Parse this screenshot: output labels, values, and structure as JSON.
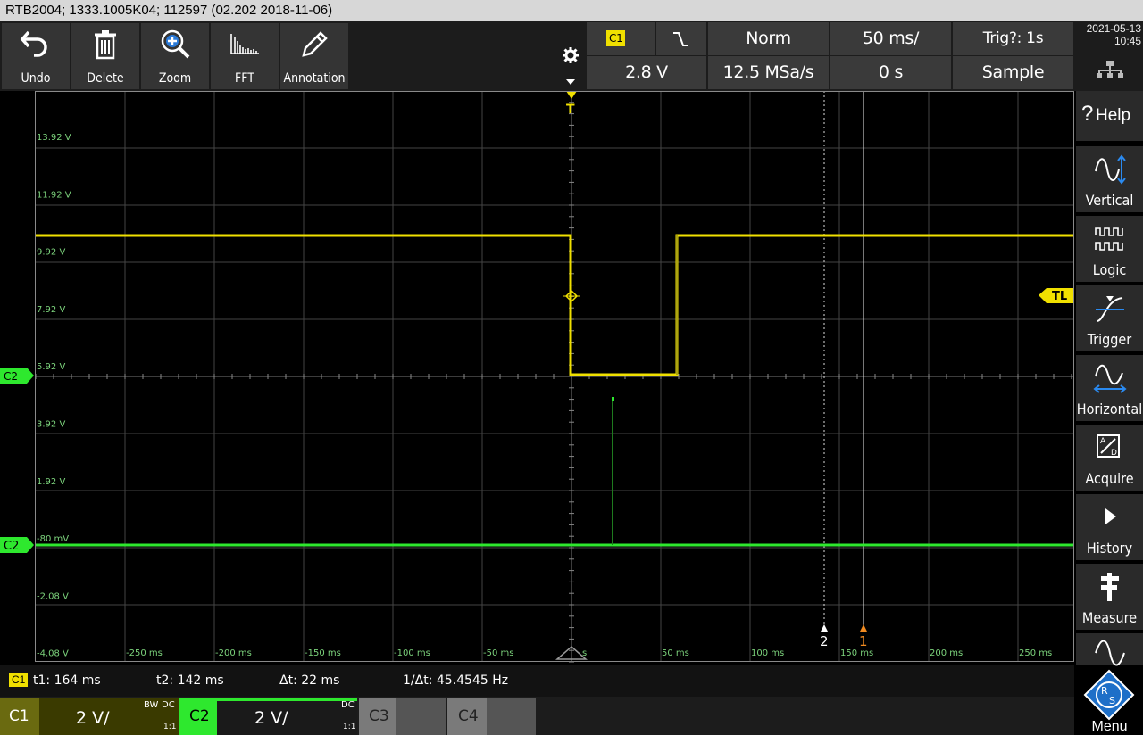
{
  "titlebar": {
    "text": "RTB2004; 1333.1005K04; 112597 (02.202 2018-11-06)"
  },
  "toolbar": {
    "tools": [
      {
        "label": "Undo",
        "icon": "undo-icon"
      },
      {
        "label": "Delete",
        "icon": "trash-icon"
      },
      {
        "label": "Zoom",
        "icon": "zoom-icon"
      },
      {
        "label": "FFT",
        "icon": "fft-icon"
      },
      {
        "label": "Annotation",
        "icon": "pencil-icon"
      }
    ],
    "trigger_source": "C1",
    "trigger_mode": "Norm",
    "timebase": "50 ms/",
    "trig_status": "Trig?: 1s",
    "trigger_level": "2.8 V",
    "sample_rate": "12.5 MSa/s",
    "horizontal_position": "0 s",
    "acquire_mode": "Sample",
    "date": "2021-05-13",
    "time": "10:45"
  },
  "graticule": {
    "y_labels": [
      "13.92 V",
      "11.92 V",
      "9.92 V",
      "7.92 V",
      "5.92 V",
      "3.92 V",
      "1.92 V",
      "-80 mV",
      "-2.08 V",
      "-4.08 V"
    ],
    "x_labels": [
      "-250 ms",
      "-200 ms",
      "-150 ms",
      "-100 ms",
      "-50 ms",
      "0 s",
      "50 ms",
      "100 ms",
      "150 ms",
      "200 ms",
      "250 ms"
    ],
    "trigger_marker": "T",
    "tl_marker": "TL",
    "c2_marker_upper": "C2",
    "c2_marker_lower": "C2",
    "cursor_2_label": "2",
    "cursor_1_label": "1"
  },
  "right_panel": [
    {
      "label": "Help",
      "icon": "help-icon"
    },
    {
      "label": "Vertical",
      "icon": "vertical-icon"
    },
    {
      "label": "Logic",
      "icon": "logic-icon"
    },
    {
      "label": "Trigger",
      "icon": "trigger-icon"
    },
    {
      "label": "Horizontal",
      "icon": "horizontal-icon"
    },
    {
      "label": "Acquire",
      "icon": "acquire-icon"
    },
    {
      "label": "History",
      "icon": "play-icon"
    },
    {
      "label": "Measure",
      "icon": "caliper-icon"
    },
    {
      "label": "",
      "icon": "wave-icon"
    }
  ],
  "menu_label": "Menu",
  "cursor_info": {
    "source": "C1",
    "t1": "t1: 164 ms",
    "t2": "t2: 142 ms",
    "dt": "Δt: 22 ms",
    "inv_dt": "1/Δt: 45.4545 Hz"
  },
  "channels": [
    {
      "name": "C1",
      "scale": "2 V/",
      "coupling_top": "DC",
      "bw": "BW",
      "ratio": "1:1",
      "color": "#e8e800"
    },
    {
      "name": "C2",
      "scale": "2 V/",
      "coupling_top": "DC",
      "ratio": "1:1",
      "color": "#2ee82e"
    },
    {
      "name": "C3"
    },
    {
      "name": "C4"
    }
  ],
  "colors": {
    "c1": "#f0e000",
    "c2": "#2ee82e",
    "grid": "#555555",
    "panel": "#2a2a2a"
  }
}
